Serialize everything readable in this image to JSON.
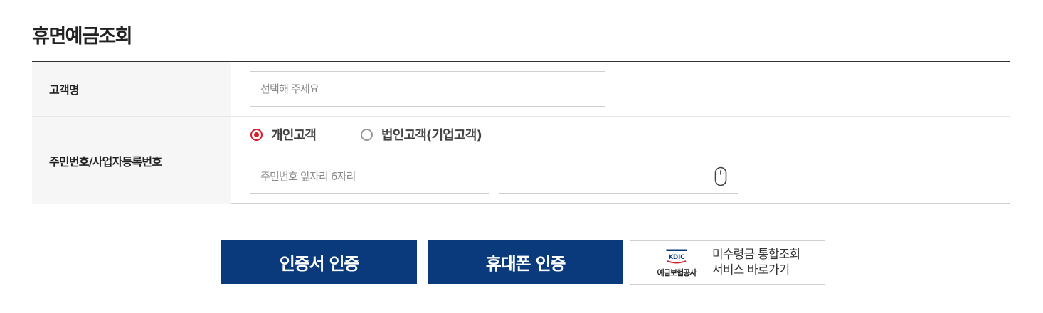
{
  "page": {
    "title": "휴면예금조회"
  },
  "form": {
    "customer_name": {
      "label": "고객명",
      "placeholder": "선택해 주세요"
    },
    "id_number": {
      "label": "주민번호/사업자등록번호",
      "radio_options": [
        {
          "label": "개인고객",
          "checked": true
        },
        {
          "label": "법인고객(기업고객)",
          "checked": false
        }
      ],
      "front_placeholder": "주민번호 앞자리 6자리",
      "back_placeholder": "",
      "back_icon": "mouse-icon"
    }
  },
  "actions": {
    "cert_button": "인증서 인증",
    "phone_button": "휴대폰 인증"
  },
  "kdic_link": {
    "logo_abbr": "KDIC",
    "logo_name": "예금보험공사",
    "line1": "미수령금 통합조회",
    "line2": "서비스 바로가기"
  },
  "colors": {
    "primary_button": "#0a3a7c",
    "radio_checked": "#d81e2a",
    "label_bg": "#f6f6f6"
  }
}
